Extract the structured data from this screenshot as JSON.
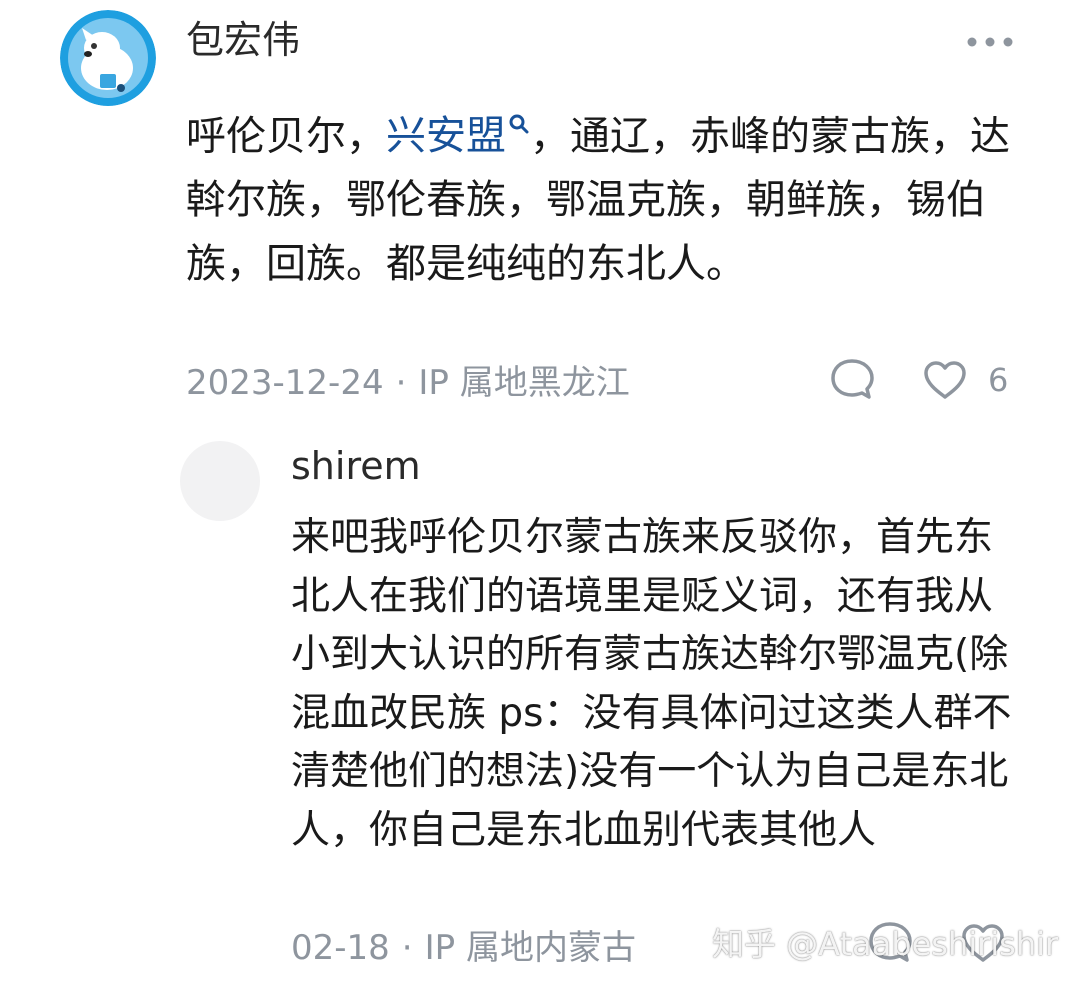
{
  "main_comment": {
    "author": "包宏伟",
    "text_before_link": "呼伦贝尔，",
    "topic_link": "兴安盟",
    "text_after_link": "，通辽，赤峰的蒙古族，达斡尔族，鄂伦春族，鄂温克族，朝鲜族，锡伯族，回族。都是纯纯的东北人。",
    "date": "2023-12-24",
    "separator": "·",
    "ip_location": "IP 属地黑龙江",
    "like_count": "6",
    "icons": {
      "more": "more-horizontal-icon",
      "topic_search": "search-icon",
      "reply": "comment-bubble-icon",
      "like": "heart-icon"
    }
  },
  "reply": {
    "author": "shirem",
    "text": "来吧我呼伦贝尔蒙古族来反驳你，首先东北人在我们的语境里是贬义词，还有我从小到大认识的所有蒙古族达斡尔鄂温克(除混血改民族 ps：没有具体问过这类人群不清楚他们的想法)没有一个认为自己是东北人，你自己是东北血别代表其他人",
    "date": "02-18",
    "separator": "·",
    "ip_location": "IP 属地内蒙古"
  },
  "watermark": "知乎 @Ataabeshirishir",
  "colors": {
    "link": "#175199",
    "meta_text": "#8e959e",
    "avatar_ring": "#1e9fe0",
    "placeholder_avatar": "#f2f2f3"
  }
}
